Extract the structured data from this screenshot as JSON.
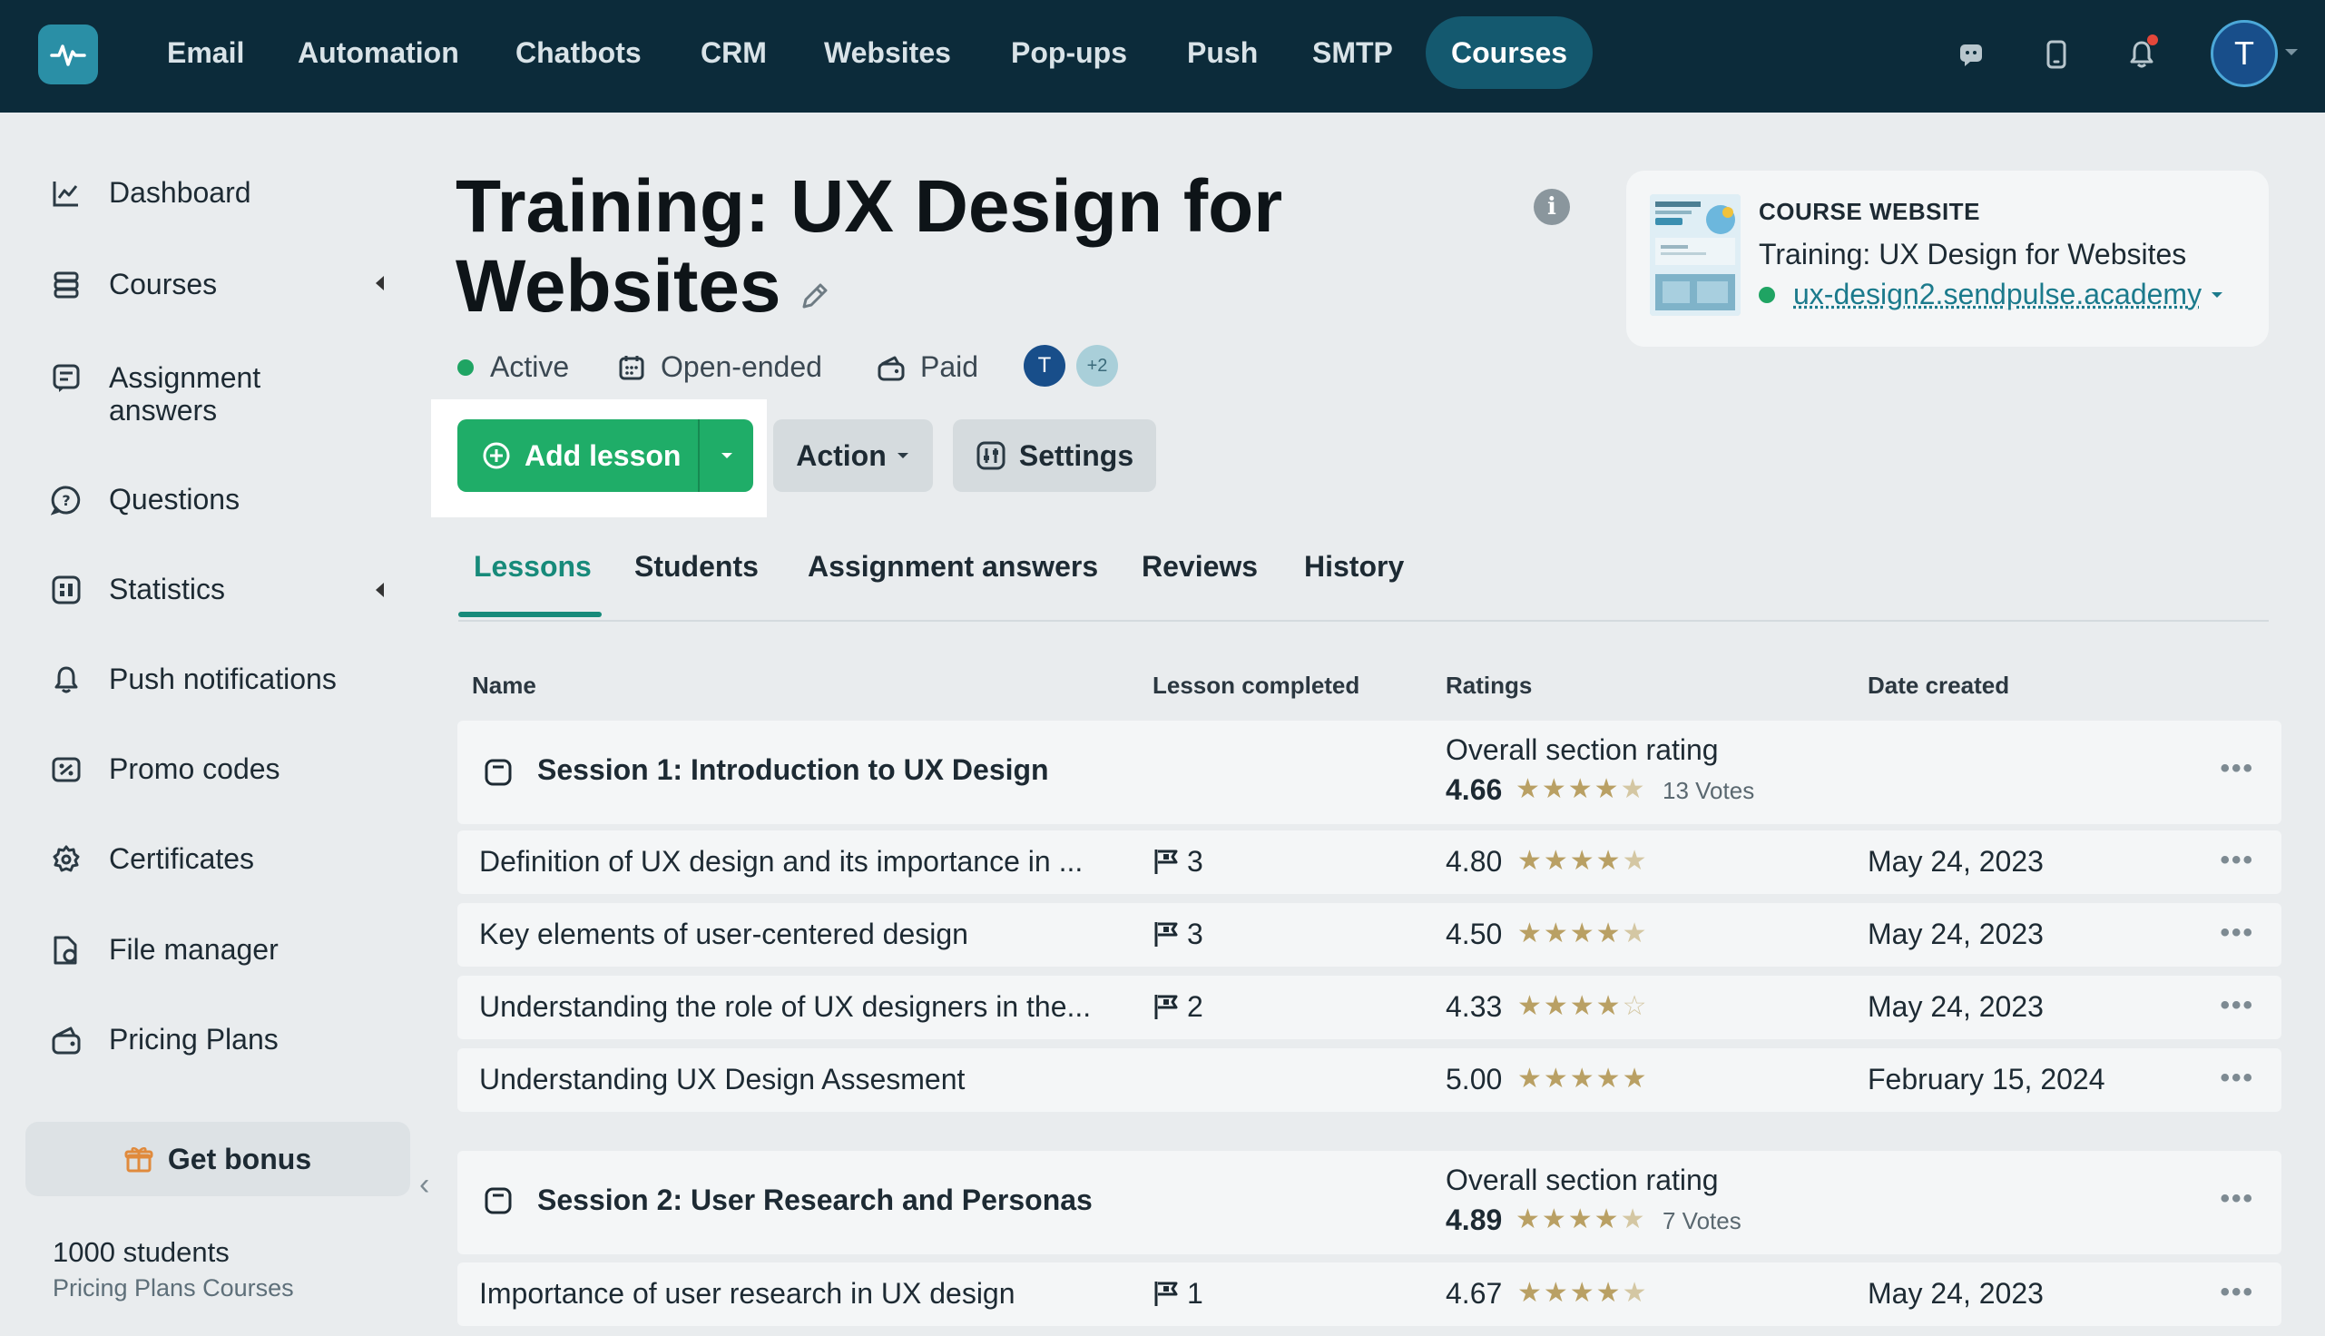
{
  "nav": {
    "items": [
      "Email",
      "Automation",
      "Chatbots",
      "CRM",
      "Websites",
      "Pop-ups",
      "Push",
      "SMTP",
      "Courses"
    ],
    "active": "Courses",
    "avatar_letter": "T",
    "icons": [
      "chat-icon",
      "mobile-icon",
      "bell-icon"
    ]
  },
  "sidebar": {
    "items": [
      {
        "label": "Dashboard",
        "icon": "chart-line-icon"
      },
      {
        "label": "Courses",
        "icon": "courses-icon"
      },
      {
        "label": "Assignment answers",
        "icon": "assignment-icon"
      },
      {
        "label": "Questions",
        "icon": "question-icon"
      },
      {
        "label": "Statistics",
        "icon": "statistics-icon"
      },
      {
        "label": "Push notifications",
        "icon": "bell-icon"
      },
      {
        "label": "Promo codes",
        "icon": "promo-icon"
      },
      {
        "label": "Certificates",
        "icon": "certificate-icon"
      },
      {
        "label": "File manager",
        "icon": "file-icon"
      },
      {
        "label": "Pricing Plans",
        "icon": "wallet-icon"
      }
    ],
    "bonus_label": "Get bonus",
    "students_count": "1000 students",
    "plan_label": "Pricing Plans Courses"
  },
  "course": {
    "title": "Training: UX Design for Websites",
    "status": "Active",
    "duration": "Open-ended",
    "price_type": "Paid",
    "avatar_letter": "T",
    "extra_members": "+2"
  },
  "website_card": {
    "label": "COURSE WEBSITE",
    "name": "Training: UX Design for Websites",
    "url": "ux-design2.sendpulse.academy"
  },
  "actions": {
    "add_lesson": "Add lesson",
    "action": "Action",
    "settings": "Settings"
  },
  "tabs": [
    "Lessons",
    "Students",
    "Assignment answers",
    "Reviews",
    "History"
  ],
  "table": {
    "headers": {
      "name": "Name",
      "completed": "Lesson completed",
      "ratings": "Ratings",
      "date": "Date created"
    },
    "sections": [
      {
        "title": "Session 1: Introduction to UX Design",
        "rating_label": "Overall section rating",
        "rating": "4.66",
        "stars": 4.66,
        "votes": "13 Votes",
        "lessons": [
          {
            "name": "Definition of UX design and its importance in ...",
            "completed": "3",
            "rating": "4.80",
            "stars": 4.5,
            "date": "May 24, 2023"
          },
          {
            "name": "Key elements of user-centered design",
            "completed": "3",
            "rating": "4.50",
            "stars": 4.5,
            "date": "May 24, 2023"
          },
          {
            "name": "Understanding the role of UX designers in the...",
            "completed": "2",
            "rating": "4.33",
            "stars": 4.0,
            "date": "May 24, 2023"
          },
          {
            "name": "Understanding UX Design Assesment",
            "completed": "",
            "rating": "5.00",
            "stars": 5.0,
            "date": "February 15, 2024"
          }
        ]
      },
      {
        "title": "Session 2: User Research and Personas",
        "rating_label": "Overall section rating",
        "rating": "4.89",
        "stars": 4.5,
        "votes": "7 Votes",
        "lessons": [
          {
            "name": "Importance of user research in UX design",
            "completed": "1",
            "rating": "4.67",
            "stars": 4.5,
            "date": "May 24, 2023"
          }
        ]
      }
    ]
  },
  "colors": {
    "topbar": "#0c2b3a",
    "accent_green": "#1fad68",
    "tab_active": "#178a7a",
    "star": "#b9a064"
  }
}
